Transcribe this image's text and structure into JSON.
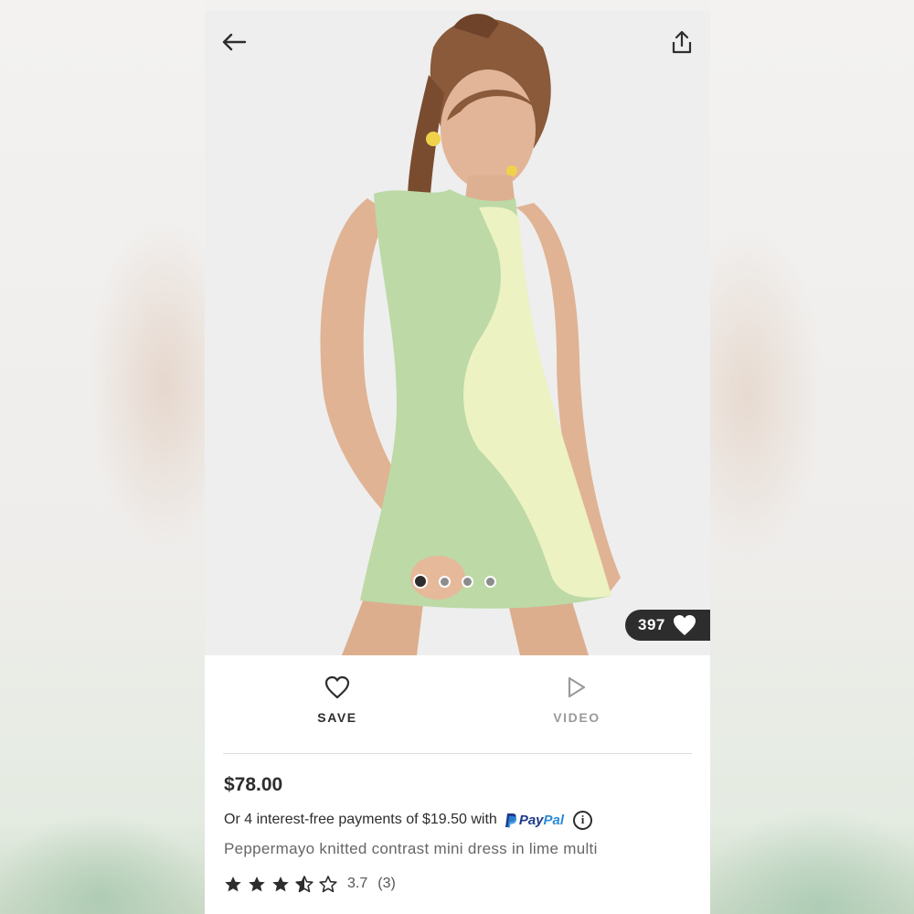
{
  "header": {
    "back_icon": "arrow-left-icon",
    "share_icon": "share-icon"
  },
  "gallery": {
    "image_count": 4,
    "active_index": 0,
    "likes": "397",
    "likes_icon": "heart-filled-icon"
  },
  "actions": {
    "save_label": "SAVE",
    "save_icon": "heart-outline-icon",
    "video_label": "VIDEO",
    "video_icon": "play-icon"
  },
  "product": {
    "price": "$78.00",
    "installments_text": "Or 4 interest-free payments of $19.50 with",
    "paypal_label_pay": "Pay",
    "paypal_label_pal": "Pal",
    "info_glyph": "i",
    "name": "Peppermayo knitted contrast mini dress in lime multi",
    "rating_value": "3.7",
    "rating_count": "(3)",
    "rating_stars": 3.5
  },
  "colors": {
    "text_primary": "#2d2d2d",
    "text_muted": "#9b9b9b",
    "paypal_dark": "#1e3a8a",
    "paypal_light": "#2a8ad8",
    "likes_badge": "#2d2d2d"
  }
}
